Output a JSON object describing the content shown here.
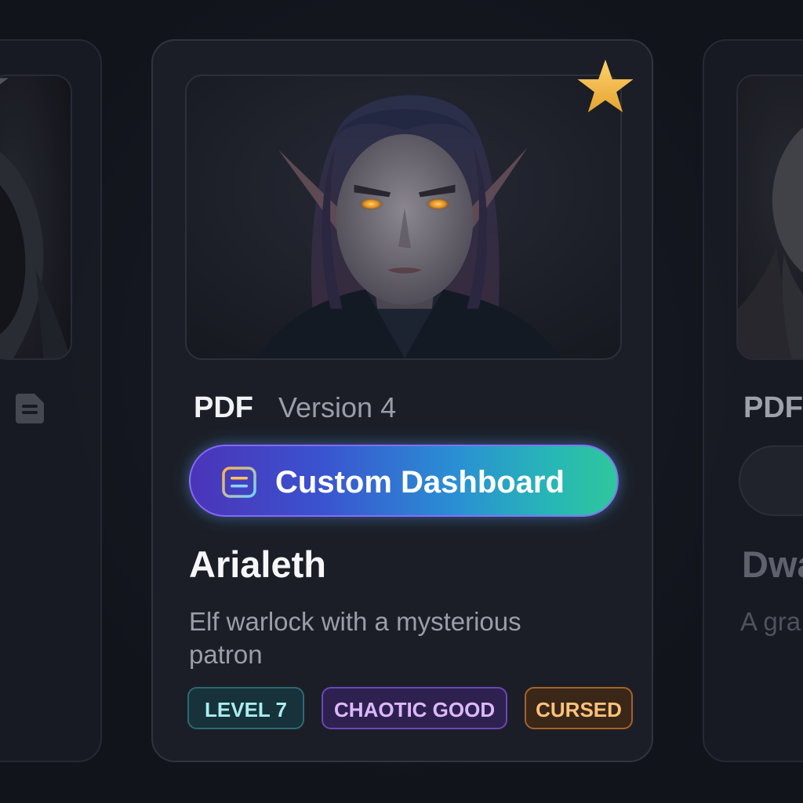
{
  "cards": {
    "left": {
      "favorited": false
    },
    "center": {
      "format": "PDF",
      "version": "Version 4",
      "favorited": true,
      "action_label": "Custom Dashboard",
      "name": "Arialeth",
      "description": "Elf warlock with a mysterious patron",
      "tags": [
        "LEVEL 7",
        "CHAOTIC GOOD",
        "CURSED"
      ]
    },
    "right": {
      "format": "PDF",
      "name": "Dwa",
      "description": "A gra"
    }
  },
  "colors": {
    "background": "#12141c",
    "card": "#1c1e27",
    "star_active": "#f2b84a",
    "star_inactive": "#5d6068",
    "tag_level": "#a8eef0",
    "tag_alignment": "#dcb8ff",
    "tag_cursed": "#ffc27a"
  }
}
